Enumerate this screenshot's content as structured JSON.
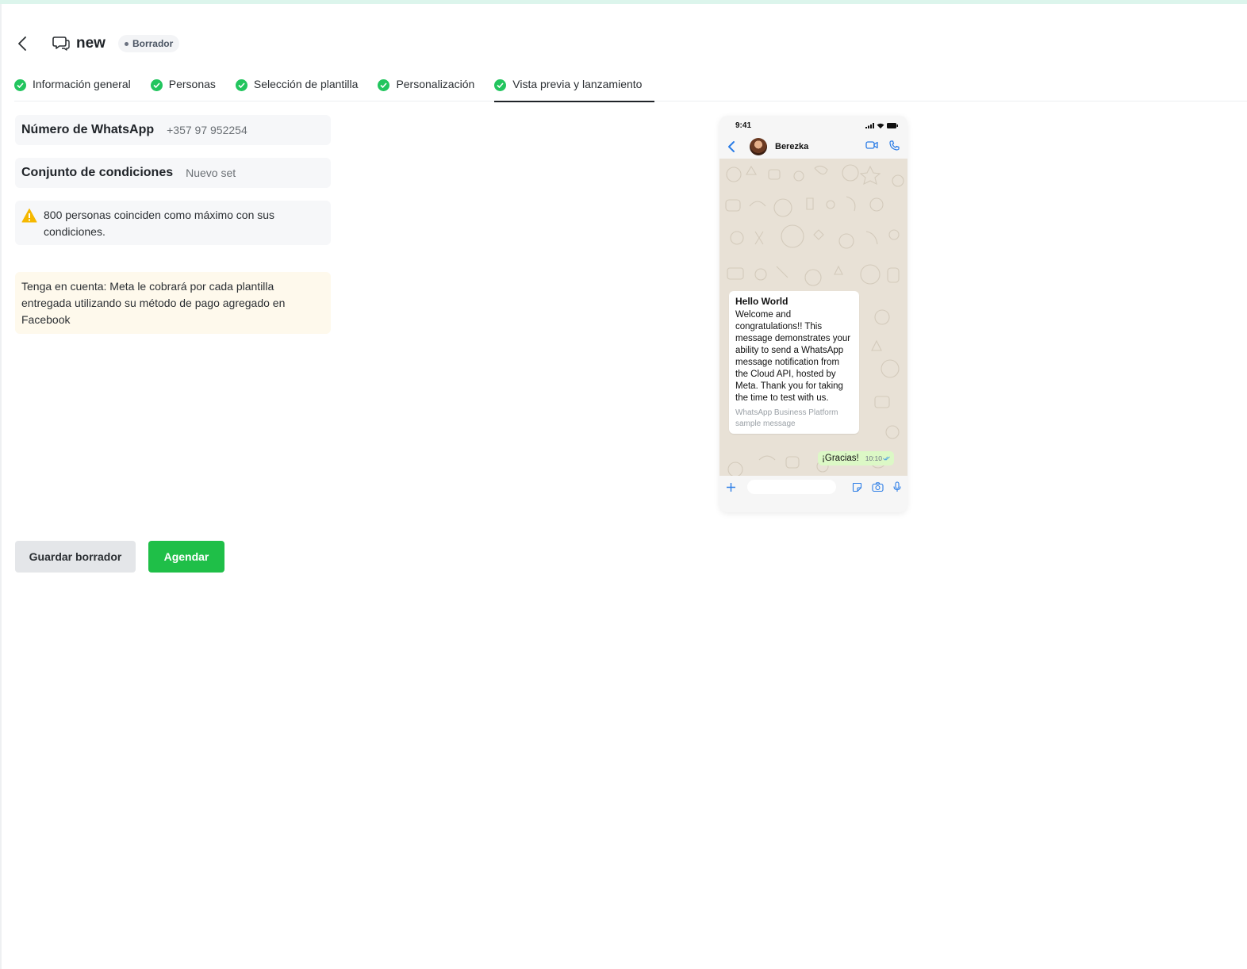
{
  "header": {
    "title": "new",
    "status": "Borrador"
  },
  "tabs": [
    {
      "label": "Información general"
    },
    {
      "label": "Personas"
    },
    {
      "label": "Selección de plantilla"
    },
    {
      "label": "Personalización"
    },
    {
      "label": "Vista previa y lanzamiento"
    }
  ],
  "fields": {
    "whatsapp_label": "Número de WhatsApp",
    "whatsapp_value": "+357 97 952254",
    "conditions_label": "Conjunto de condiciones",
    "conditions_value": "Nuevo set"
  },
  "warning": {
    "text": "800 personas coinciden como máximo con sus condiciones."
  },
  "note": {
    "text": "Tenga en cuenta: Meta le cobrará por cada plantilla entregada utilizando su método de pago agregado en Facebook"
  },
  "buttons": {
    "save_draft": "Guardar borrador",
    "schedule": "Agendar"
  },
  "preview": {
    "time": "9:41",
    "contact": "Berezka",
    "message_title": "Hello World",
    "message_body": "Welcome and congratulations!! This message demonstrates your ability to send a WhatsApp message notification from the Cloud API, hosted by Meta. Thank you for taking the time to test with us.",
    "message_footer": "WhatsApp Business Platform sample message",
    "reply_text": "¡Gracias!",
    "reply_time": "10:10"
  },
  "colors": {
    "accent_green": "#1fbf48",
    "check_green": "#22c55e",
    "note_bg": "#fef9ec",
    "ios_blue": "#2a7ce6"
  }
}
